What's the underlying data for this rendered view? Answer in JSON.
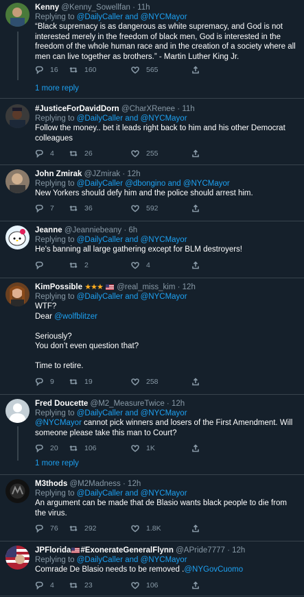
{
  "tweets": [
    {
      "name": "Kenny",
      "handle": "@Kenny_Sowellfan",
      "time": "11h",
      "replying_prefix": "Replying to",
      "mentions": [
        "@DailyCaller",
        "and",
        "@NYCMayor"
      ],
      "text": "“Black supremacy is as dangerous as white supremacy, and God is not interested merely in the freedom of black men, God is interested in the freedom of the whole human race and in the creation of a society where all men can live together as brothers.” - Martin Luther King Jr.",
      "replies": "16",
      "retweets": "160",
      "likes": "565",
      "more_replies": "1 more reply"
    },
    {
      "name": "#JusticeForDavidDorn",
      "handle": "@CharXRenee",
      "time": "11h",
      "replying_prefix": "Replying to",
      "mentions": [
        "@DailyCaller",
        "and",
        "@NYCMayor"
      ],
      "text": "Follow the money.. bet it leads right back to him and his other Democrat colleagues",
      "replies": "4",
      "retweets": "26",
      "likes": "255"
    },
    {
      "name": "John Zmirak",
      "handle": "@JZmirak",
      "time": "12h",
      "replying_prefix": "Replying to",
      "mentions": [
        "@DailyCaller",
        "@dbongino",
        "and",
        "@NYCMayor"
      ],
      "text": "New Yorkers should defy him and the police should arrest him.",
      "replies": "7",
      "retweets": "36",
      "likes": "592"
    },
    {
      "name": "Jeanne",
      "handle": "@Jeanniebeany",
      "time": "6h",
      "replying_prefix": "Replying to",
      "mentions": [
        "@DailyCaller",
        "and",
        "@NYCMayor"
      ],
      "text": "He's banning all large gathering except for BLM destroyers!",
      "replies": "",
      "retweets": "2",
      "likes": "4"
    },
    {
      "name": "KimPossible",
      "name_suffix": "★★★",
      "handle": "@real_miss_kim",
      "time": "12h",
      "replying_prefix": "Replying to",
      "mentions": [
        "@DailyCaller",
        "and",
        "@NYCMayor"
      ],
      "text_lines": [
        "WTF?",
        "Dear",
        "",
        "Seriously?",
        "You don’t even question that?",
        "",
        "Time to retire."
      ],
      "dear_mention": "@wolfblitzer",
      "replies": "9",
      "retweets": "19",
      "likes": "258"
    },
    {
      "name": "Fred Doucette",
      "handle": "@M2_MeasureTwice",
      "time": "12h",
      "replying_prefix": "Replying to",
      "mentions": [
        "@DailyCaller",
        "and",
        "@NYCMayor"
      ],
      "text_mention": "@NYCMayor",
      "text": " cannot pick winners and losers of the First Amendment. Will someone please take this man to Court?",
      "replies": "20",
      "retweets": "106",
      "likes": "1K",
      "more_replies": "1 more reply"
    },
    {
      "name": "M3thods",
      "handle": "@M2Madness",
      "time": "12h",
      "replying_prefix": "Replying to",
      "mentions": [
        "@DailyCaller",
        "and",
        "@NYCMayor"
      ],
      "text": "An argument can be made that de Blasio wants black people to die from the virus.",
      "replies": "76",
      "retweets": "292",
      "likes": "1.8K"
    },
    {
      "name_pre": "JPFlorida",
      "name": "#ExonerateGeneralFlynn",
      "handle": "@APride7777",
      "time": "12h",
      "replying_prefix": "Replying to",
      "mentions": [
        "@DailyCaller",
        "and",
        "@NYCMayor"
      ],
      "text": "Comrade De Blasio needs to be removed .",
      "text_mention": "@NYGovCuomo",
      "replies": "4",
      "retweets": "23",
      "likes": "106"
    }
  ],
  "icons": {
    "reply": "reply-icon",
    "retweet": "retweet-icon",
    "like": "heart-icon",
    "share": "share-icon"
  },
  "colors": {
    "background": "#15202b",
    "border": "#38444d",
    "muted": "#8899a6",
    "accent": "#1da1f2"
  }
}
